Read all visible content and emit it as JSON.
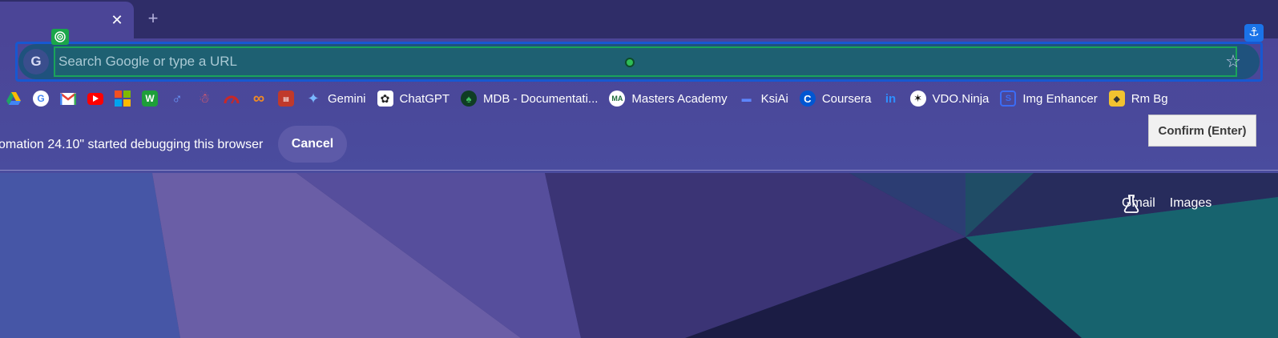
{
  "tabstrip": {
    "close_glyph": "✕",
    "new_tab_glyph": "+"
  },
  "omnibox": {
    "placeholder": "Search Google or type a URL",
    "search_engine_letter": "G"
  },
  "bookmarks": [
    {
      "icon": "google-drive-icon",
      "label": "",
      "color": "#2f9e44"
    },
    {
      "icon": "google-icon",
      "label": "",
      "color": "#ffffff"
    },
    {
      "icon": "gmail-icon",
      "label": "",
      "color": "#ea4335"
    },
    {
      "icon": "youtube-icon",
      "label": "",
      "color": "#ff0000"
    },
    {
      "icon": "microsoft-icon",
      "label": "",
      "color": "#f25022"
    },
    {
      "icon": "green-app-icon",
      "label": "",
      "color": "#1e9e3a"
    },
    {
      "icon": "blue-app-icon",
      "label": "",
      "color": "#4f7cff"
    },
    {
      "icon": "santa-icon",
      "label": "",
      "color": "#ffffff"
    },
    {
      "icon": "speedometer-icon",
      "label": "",
      "color": "#c82828"
    },
    {
      "icon": "infinity-icon",
      "label": "",
      "color": "#f08a24"
    },
    {
      "icon": "book-icon",
      "label": "",
      "color": "#c0392b"
    },
    {
      "icon": "gemini-icon",
      "label": "Gemini",
      "color": "#7ab8ff"
    },
    {
      "icon": "chatgpt-icon",
      "label": "ChatGPT",
      "color": "#ffffff"
    },
    {
      "icon": "mongodb-icon",
      "label": "MDB - Documentati...",
      "color": "#1f6b3a"
    },
    {
      "icon": "masters-academy-icon",
      "label": "Masters Academy",
      "color": "#ffffff"
    },
    {
      "icon": "ksiai-icon",
      "label": "KsiAi",
      "color": "#2a5bd7"
    },
    {
      "icon": "coursera-icon",
      "label": "Coursera",
      "color": "#0056d2"
    },
    {
      "icon": "linkedin-icon",
      "label": "",
      "color": "#0a66c2"
    },
    {
      "icon": "vdo-ninja-icon",
      "label": "VDO.Ninja",
      "color": "#ffffff"
    },
    {
      "icon": "img-enhancer-icon",
      "label": "Img Enhancer",
      "color": "#3b6cf5"
    },
    {
      "icon": "rm-bg-icon",
      "label": "Rm Bg",
      "color": "#f2c230"
    }
  ],
  "debug_bar": {
    "message": "omation 24.10\" started debugging this browser",
    "cancel_label": "Cancel"
  },
  "tooltip": {
    "text": "Confirm (Enter)"
  },
  "page": {
    "links": [
      "Gmail",
      "Images"
    ]
  }
}
